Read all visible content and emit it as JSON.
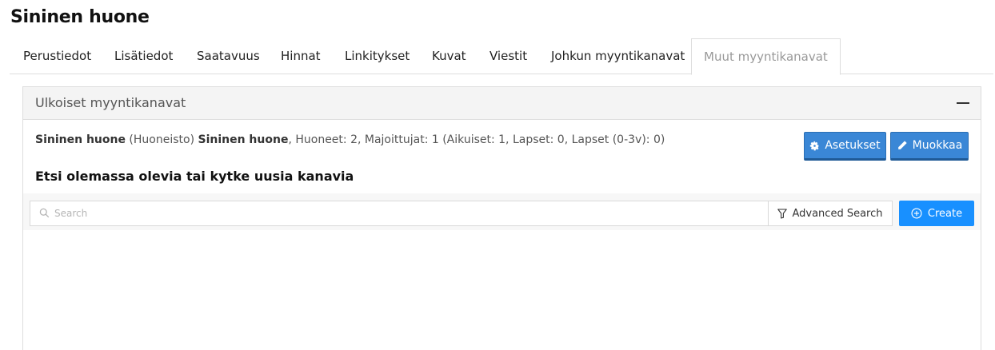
{
  "page": {
    "title": "Sininen huone"
  },
  "tabs": [
    {
      "label": "Perustiedot"
    },
    {
      "label": "Lisätiedot"
    },
    {
      "label": "Saatavuus"
    },
    {
      "label": "Hinnat"
    },
    {
      "label": "Linkitykset"
    },
    {
      "label": "Kuvat"
    },
    {
      "label": "Viestit"
    },
    {
      "label": "Johkun myyntikanavat"
    },
    {
      "label": "Muut myyntikanavat",
      "active": true
    }
  ],
  "panel": {
    "title": "Ulkoiset myyntikanavat",
    "info": {
      "room_name": "Sininen huone",
      "room_type": " (Huoneisto) ",
      "room_name2": "Sininen huone",
      "details": ", Huoneet: 2, Majoittujat: 1 (Aikuiset: 1, Lapset: 0, Lapset (0-3v): 0)"
    },
    "settings_button": "Asetukset",
    "edit_button": "Muokkaa",
    "section_heading": "Etsi olemassa olevia tai kytke uusia kanavia"
  },
  "search": {
    "placeholder": "Search",
    "value": "",
    "advanced_label": "Advanced Search",
    "create_label": "Create"
  },
  "icons": {
    "settings": "gear-icon",
    "edit": "pencil-icon",
    "search": "search-icon",
    "advanced": "filter-icon",
    "create": "plus-circle-icon",
    "collapse": "minus-icon"
  },
  "colors": {
    "primary_button": "#3a87d6",
    "create_button": "#1890ff",
    "active_tab_text": "#999999"
  }
}
